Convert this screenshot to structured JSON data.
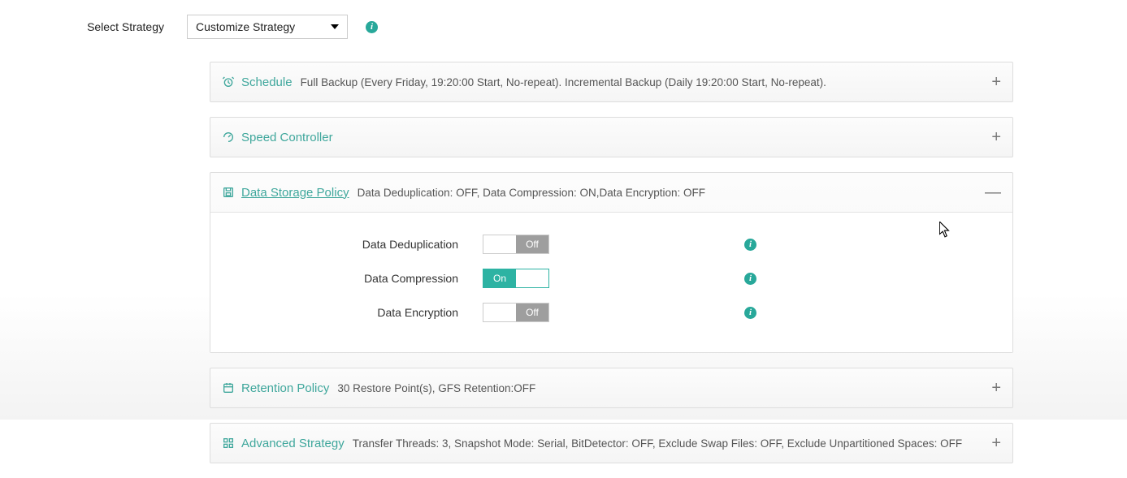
{
  "strategy": {
    "label": "Select Strategy",
    "value": "Customize Strategy"
  },
  "panels": {
    "schedule": {
      "title": "Schedule",
      "summary": "Full Backup (Every Friday, 19:20:00 Start, No-repeat). Incremental Backup (Daily 19:20:00 Start, No-repeat)."
    },
    "speed": {
      "title": "Speed Controller"
    },
    "storage": {
      "title": "Data Storage Policy",
      "summary": "Data Deduplication: OFF, Data Compression: ON,Data Encryption: OFF",
      "options": {
        "dedup": {
          "label": "Data Deduplication",
          "state": "Off"
        },
        "compress": {
          "label": "Data Compression",
          "state": "On"
        },
        "encrypt": {
          "label": "Data Encryption",
          "state": "Off"
        }
      }
    },
    "retention": {
      "title": "Retention Policy",
      "summary": "30 Restore Point(s), GFS Retention:OFF"
    },
    "advanced": {
      "title": "Advanced Strategy",
      "summary": "Transfer Threads: 3, Snapshot Mode: Serial, BitDetector: OFF, Exclude Swap Files: OFF, Exclude Unpartitioned Spaces: OFF"
    }
  },
  "glyphs": {
    "plus": "+",
    "minus": "—",
    "info": "i"
  }
}
